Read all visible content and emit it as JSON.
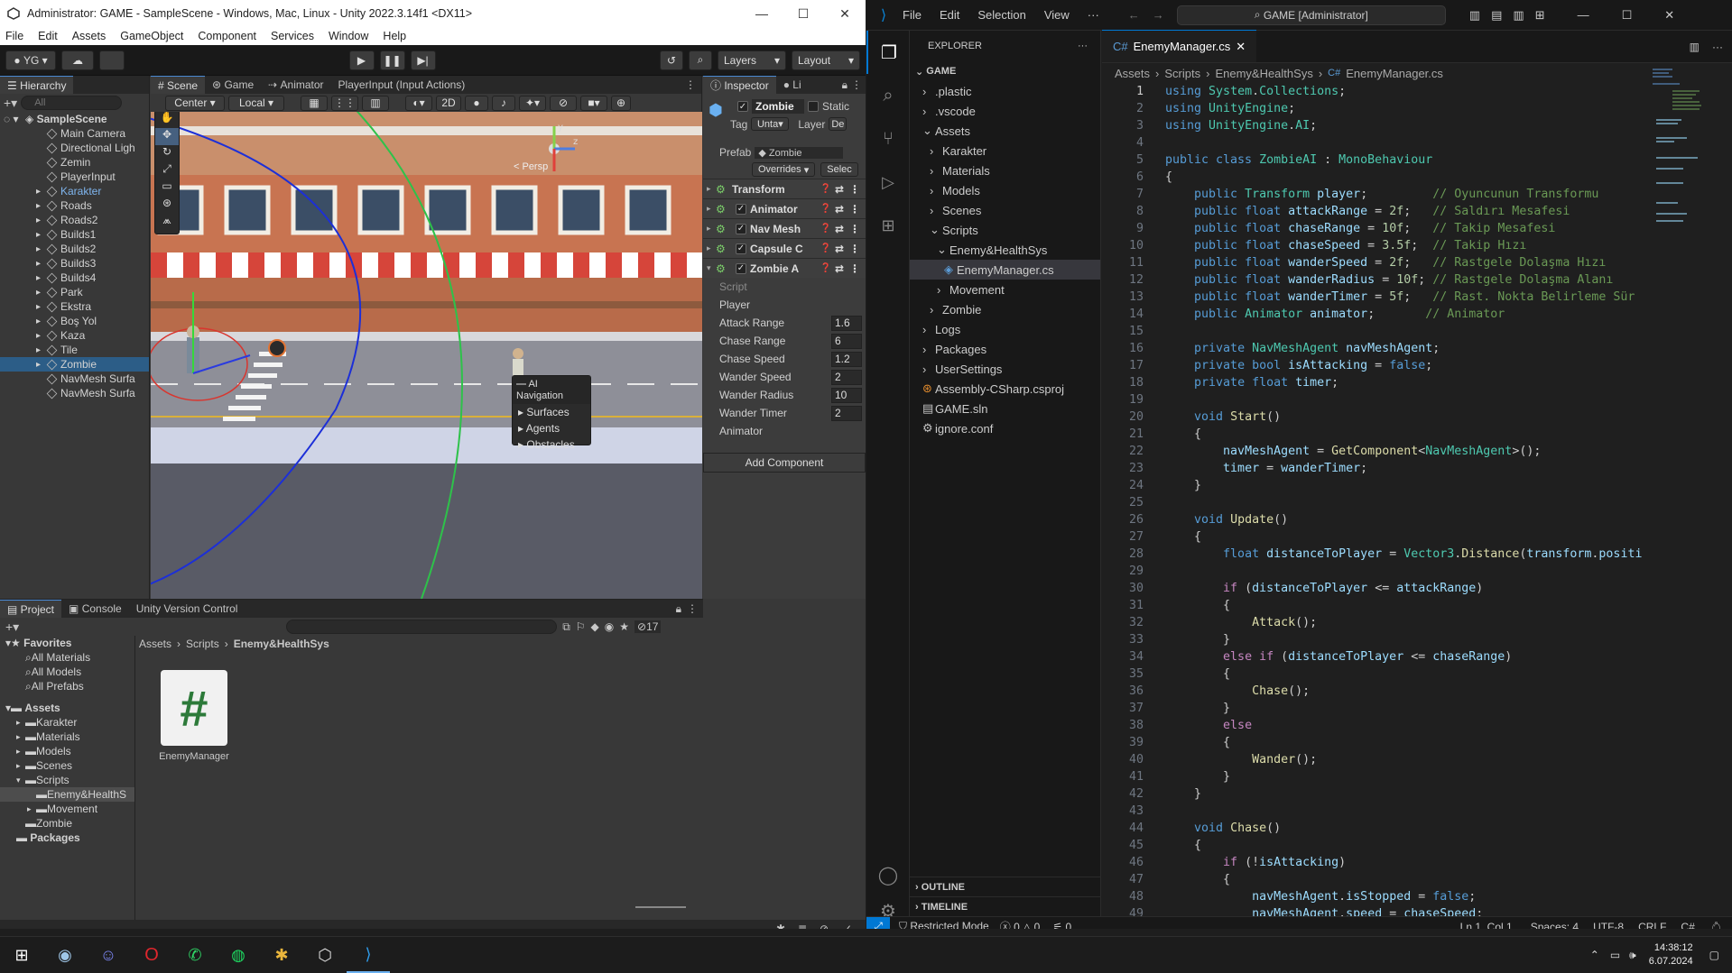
{
  "unity": {
    "title": "Administrator: GAME - SampleScene - Windows, Mac, Linux - Unity 2022.3.14f1 <DX11>",
    "menu": [
      "File",
      "Edit",
      "Assets",
      "GameObject",
      "Component",
      "Services",
      "Window",
      "Help"
    ],
    "account": "YG",
    "layers_label": "Layers",
    "layout_label": "Layout",
    "hierarchy": {
      "tab": "Hierarchy",
      "search_placeholder": "All",
      "scene": "SampleScene",
      "items": [
        "Main Camera",
        "Directional Ligh",
        "Zemin",
        "PlayerInput",
        "Karakter",
        "Roads",
        "Roads2",
        "Builds1",
        "Builds2",
        "Builds3",
        "Builds4",
        "Park",
        "Ekstra",
        "Boş Yol",
        "Kaza",
        "Tile",
        "Zombie",
        "NavMesh Surfa",
        "NavMesh Surfa"
      ]
    },
    "scene_tabs": [
      "Scene",
      "Game",
      "Animator",
      "PlayerInput (Input Actions)"
    ],
    "scene_toolbar": {
      "pivot": "Center",
      "space": "Local",
      "mode2d": "2D"
    },
    "scene_persp": "< Persp",
    "ai_nav": {
      "title": "AI Navigation",
      "items": [
        "Surfaces",
        "Agents",
        "Obstacles"
      ]
    },
    "inspector": {
      "tabs": [
        "Inspector",
        "Li"
      ],
      "object_name": "Zombie",
      "static_label": "Static",
      "tag_label": "Tag",
      "tag_value": "Unta",
      "layer_label": "Layer",
      "layer_value": "De",
      "prefab_label": "Prefab",
      "prefab_value": "Zombie",
      "overrides": "Overrides",
      "select": "Selec",
      "components": [
        "Transform",
        "Animator",
        "Nav Mesh",
        "Capsule C",
        "Zombie A"
      ],
      "fields": [
        {
          "label": "Script",
          "value": ""
        },
        {
          "label": "Player",
          "value": ""
        },
        {
          "label": "Attack Range",
          "value": "1.6"
        },
        {
          "label": "Chase Range",
          "value": "6"
        },
        {
          "label": "Chase Speed",
          "value": "1.2"
        },
        {
          "label": "Wander Speed",
          "value": "2"
        },
        {
          "label": "Wander Radius",
          "value": "10"
        },
        {
          "label": "Wander Timer",
          "value": "2"
        },
        {
          "label": "Animator",
          "value": ""
        }
      ],
      "add_component": "Add Component"
    },
    "project": {
      "tabs": [
        "Project",
        "Console",
        "Unity Version Control"
      ],
      "count": "17",
      "favorites_label": "Favorites",
      "favorites": [
        "All Materials",
        "All Models",
        "All Prefabs"
      ],
      "assets_label": "Assets",
      "assets": [
        "Karakter",
        "Materials",
        "Models",
        "Scenes",
        "Scripts"
      ],
      "scripts_children": [
        "Enemy&HealthS",
        "Movement"
      ],
      "assets_tail": [
        "Zombie"
      ],
      "packages_label": "Packages",
      "breadcrumb": [
        "Assets",
        "Scripts",
        "Enemy&HealthSys"
      ],
      "file_name": "EnemyManager"
    }
  },
  "vscode": {
    "menu": [
      "File",
      "Edit",
      "Selection",
      "View",
      "···"
    ],
    "search": "GAME [Administrator]",
    "explorer": {
      "title": "EXPLORER",
      "root": "GAME",
      "items": [
        {
          "label": ".plastic",
          "depth": 1,
          "type": "folder"
        },
        {
          "label": ".vscode",
          "depth": 1,
          "type": "folder"
        },
        {
          "label": "Assets",
          "depth": 1,
          "type": "folder-open"
        },
        {
          "label": "Karakter",
          "depth": 2,
          "type": "folder"
        },
        {
          "label": "Materials",
          "depth": 2,
          "type": "folder"
        },
        {
          "label": "Models",
          "depth": 2,
          "type": "folder"
        },
        {
          "label": "Scenes",
          "depth": 2,
          "type": "folder"
        },
        {
          "label": "Scripts",
          "depth": 2,
          "type": "folder-open"
        },
        {
          "label": "Enemy&HealthSys",
          "depth": 3,
          "type": "folder-open"
        },
        {
          "label": "EnemyManager.cs",
          "depth": 4,
          "type": "cs",
          "selected": true
        },
        {
          "label": "Movement",
          "depth": 3,
          "type": "folder"
        },
        {
          "label": "Zombie",
          "depth": 2,
          "type": "folder"
        },
        {
          "label": "Logs",
          "depth": 1,
          "type": "folder"
        },
        {
          "label": "Packages",
          "depth": 1,
          "type": "folder"
        },
        {
          "label": "UserSettings",
          "depth": 1,
          "type": "folder"
        },
        {
          "label": "Assembly-CSharp.csproj",
          "depth": 1,
          "type": "rss"
        },
        {
          "label": "GAME.sln",
          "depth": 1,
          "type": "sln"
        },
        {
          "label": "ignore.conf",
          "depth": 1,
          "type": "gear"
        }
      ],
      "outline": "OUTLINE",
      "timeline": "TIMELINE"
    },
    "tab_name": "EnemyManager.cs",
    "breadcrumb": [
      "Assets",
      "Scripts",
      "Enemy&HealthSys",
      "EnemyManager.cs"
    ],
    "code": [
      [
        [
          "kw",
          "using "
        ],
        [
          "ty",
          "System"
        ],
        [
          "",
          "."
        ],
        [
          "ty",
          "Collections"
        ],
        [
          "",
          ";"
        ]
      ],
      [
        [
          "kw",
          "using "
        ],
        [
          "ty",
          "UnityEngine"
        ],
        [
          "",
          ";"
        ]
      ],
      [
        [
          "kw",
          "using "
        ],
        [
          "ty",
          "UnityEngine"
        ],
        [
          "",
          "."
        ],
        [
          "ty",
          "AI"
        ],
        [
          "",
          ";"
        ]
      ],
      [],
      [
        [
          "kw",
          "public class "
        ],
        [
          "ty",
          "ZombieAI"
        ],
        [
          "",
          " : "
        ],
        [
          "ty",
          "MonoBehaviour"
        ]
      ],
      [
        [
          "",
          "{"
        ]
      ],
      [
        [
          "",
          "    "
        ],
        [
          "kw",
          "public "
        ],
        [
          "ty",
          "Transform "
        ],
        [
          "vr",
          "player"
        ],
        [
          "",
          ";         "
        ],
        [
          "cm",
          "// Oyuncunun Transformu"
        ]
      ],
      [
        [
          "",
          "    "
        ],
        [
          "kw",
          "public float "
        ],
        [
          "vr",
          "attackRange"
        ],
        [
          "",
          " = "
        ],
        [
          "nm",
          "2f"
        ],
        [
          "",
          ";   "
        ],
        [
          "cm",
          "// Saldırı Mesafesi"
        ]
      ],
      [
        [
          "",
          "    "
        ],
        [
          "kw",
          "public float "
        ],
        [
          "vr",
          "chaseRange"
        ],
        [
          "",
          " = "
        ],
        [
          "nm",
          "10f"
        ],
        [
          "",
          ";   "
        ],
        [
          "cm",
          "// Takip Mesafesi"
        ]
      ],
      [
        [
          "",
          "    "
        ],
        [
          "kw",
          "public float "
        ],
        [
          "vr",
          "chaseSpeed"
        ],
        [
          "",
          " = "
        ],
        [
          "nm",
          "3.5f"
        ],
        [
          "",
          ";  "
        ],
        [
          "cm",
          "// Takip Hızı"
        ]
      ],
      [
        [
          "",
          "    "
        ],
        [
          "kw",
          "public float "
        ],
        [
          "vr",
          "wanderSpeed"
        ],
        [
          "",
          " = "
        ],
        [
          "nm",
          "2f"
        ],
        [
          "",
          ";   "
        ],
        [
          "cm",
          "// Rastgele Dolaşma Hızı"
        ]
      ],
      [
        [
          "",
          "    "
        ],
        [
          "kw",
          "public float "
        ],
        [
          "vr",
          "wanderRadius"
        ],
        [
          "",
          " = "
        ],
        [
          "nm",
          "10f"
        ],
        [
          "",
          ";"
        ],
        [
          "cm",
          " // Rastgele Dolaşma Alanı"
        ]
      ],
      [
        [
          "",
          "    "
        ],
        [
          "kw",
          "public float "
        ],
        [
          "vr",
          "wanderTimer"
        ],
        [
          "",
          " = "
        ],
        [
          "nm",
          "5f"
        ],
        [
          "",
          ";   "
        ],
        [
          "cm",
          "// Rast. Nokta Belirleme Sür"
        ]
      ],
      [
        [
          "",
          "    "
        ],
        [
          "kw",
          "public "
        ],
        [
          "ty",
          "Animator "
        ],
        [
          "vr",
          "animator"
        ],
        [
          "",
          ";       "
        ],
        [
          "cm",
          "// Animator"
        ]
      ],
      [],
      [
        [
          "",
          "    "
        ],
        [
          "kw",
          "private "
        ],
        [
          "ty",
          "NavMeshAgent "
        ],
        [
          "vr",
          "navMeshAgent"
        ],
        [
          "",
          ";"
        ]
      ],
      [
        [
          "",
          "    "
        ],
        [
          "kw",
          "private bool "
        ],
        [
          "vr",
          "isAttacking"
        ],
        [
          "",
          " = "
        ],
        [
          "kw",
          "false"
        ],
        [
          "",
          ";"
        ]
      ],
      [
        [
          "",
          "    "
        ],
        [
          "kw",
          "private float "
        ],
        [
          "vr",
          "timer"
        ],
        [
          "",
          ";"
        ]
      ],
      [],
      [
        [
          "",
          "    "
        ],
        [
          "kw",
          "void "
        ],
        [
          "fn",
          "Start"
        ],
        [
          "",
          "()"
        ]
      ],
      [
        [
          "",
          "    {"
        ]
      ],
      [
        [
          "",
          "        "
        ],
        [
          "vr",
          "navMeshAgent"
        ],
        [
          "",
          " = "
        ],
        [
          "fn",
          "GetComponent"
        ],
        [
          "",
          "<"
        ],
        [
          "ty",
          "NavMeshAgent"
        ],
        [
          "",
          ">();"
        ]
      ],
      [
        [
          "",
          "        "
        ],
        [
          "vr",
          "timer"
        ],
        [
          "",
          " = "
        ],
        [
          "vr",
          "wanderTimer"
        ],
        [
          "",
          ";"
        ]
      ],
      [
        [
          "",
          "    }"
        ]
      ],
      [],
      [
        [
          "",
          "    "
        ],
        [
          "kw",
          "void "
        ],
        [
          "fn",
          "Update"
        ],
        [
          "",
          "()"
        ]
      ],
      [
        [
          "",
          "    {"
        ]
      ],
      [
        [
          "",
          "        "
        ],
        [
          "kw",
          "float "
        ],
        [
          "vr",
          "distanceToPlayer"
        ],
        [
          "",
          " = "
        ],
        [
          "ty",
          "Vector3"
        ],
        [
          "",
          "."
        ],
        [
          "fn",
          "Distance"
        ],
        [
          "",
          "("
        ],
        [
          "vr",
          "transform"
        ],
        [
          "",
          "."
        ],
        [
          "vr",
          "positi"
        ]
      ],
      [],
      [
        [
          "",
          "        "
        ],
        [
          "ctl",
          "if "
        ],
        [
          "",
          "("
        ],
        [
          "vr",
          "distanceToPlayer"
        ],
        [
          "",
          " <= "
        ],
        [
          "vr",
          "attackRange"
        ],
        [
          "",
          ")"
        ]
      ],
      [
        [
          "",
          "        {"
        ]
      ],
      [
        [
          "",
          "            "
        ],
        [
          "fn",
          "Attack"
        ],
        [
          "",
          "();"
        ]
      ],
      [
        [
          "",
          "        }"
        ]
      ],
      [
        [
          "",
          "        "
        ],
        [
          "ctl",
          "else if "
        ],
        [
          "",
          "("
        ],
        [
          "vr",
          "distanceToPlayer"
        ],
        [
          "",
          " <= "
        ],
        [
          "vr",
          "chaseRange"
        ],
        [
          "",
          ")"
        ]
      ],
      [
        [
          "",
          "        {"
        ]
      ],
      [
        [
          "",
          "            "
        ],
        [
          "fn",
          "Chase"
        ],
        [
          "",
          "();"
        ]
      ],
      [
        [
          "",
          "        }"
        ]
      ],
      [
        [
          "",
          "        "
        ],
        [
          "ctl",
          "else"
        ]
      ],
      [
        [
          "",
          "        {"
        ]
      ],
      [
        [
          "",
          "            "
        ],
        [
          "fn",
          "Wander"
        ],
        [
          "",
          "();"
        ]
      ],
      [
        [
          "",
          "        }"
        ]
      ],
      [
        [
          "",
          "    }"
        ]
      ],
      [],
      [
        [
          "",
          "    "
        ],
        [
          "kw",
          "void "
        ],
        [
          "fn",
          "Chase"
        ],
        [
          "",
          "()"
        ]
      ],
      [
        [
          "",
          "    {"
        ]
      ],
      [
        [
          "",
          "        "
        ],
        [
          "ctl",
          "if "
        ],
        [
          "",
          "(!"
        ],
        [
          "vr",
          "isAttacking"
        ],
        [
          "",
          ")"
        ]
      ],
      [
        [
          "",
          "        {"
        ]
      ],
      [
        [
          "",
          "            "
        ],
        [
          "vr",
          "navMeshAgent"
        ],
        [
          "",
          "."
        ],
        [
          "vr",
          "isStopped"
        ],
        [
          "",
          " = "
        ],
        [
          "kw",
          "false"
        ],
        [
          "",
          ";"
        ]
      ],
      [
        [
          "",
          "            "
        ],
        [
          "vr",
          "navMeshAgent"
        ],
        [
          "",
          "."
        ],
        [
          "vr",
          "speed"
        ],
        [
          "",
          " = "
        ],
        [
          "vr",
          "chaseSpeed"
        ],
        [
          "",
          ";"
        ]
      ]
    ],
    "status": {
      "restricted": "Restricted Mode",
      "errors": "0",
      "warnings": "0",
      "ports": "0",
      "position": "Ln 1, Col 1",
      "spaces": "Spaces: 4",
      "encoding": "UTF-8",
      "eol": "CRLF",
      "lang": "C#"
    }
  },
  "taskbar": {
    "time": "14:38:12",
    "date": "6.07.2024"
  },
  "colors": {
    "accent": "#0078d4",
    "unity_select": "#2c5d87",
    "vscode_bg": "#1f1f1f"
  }
}
